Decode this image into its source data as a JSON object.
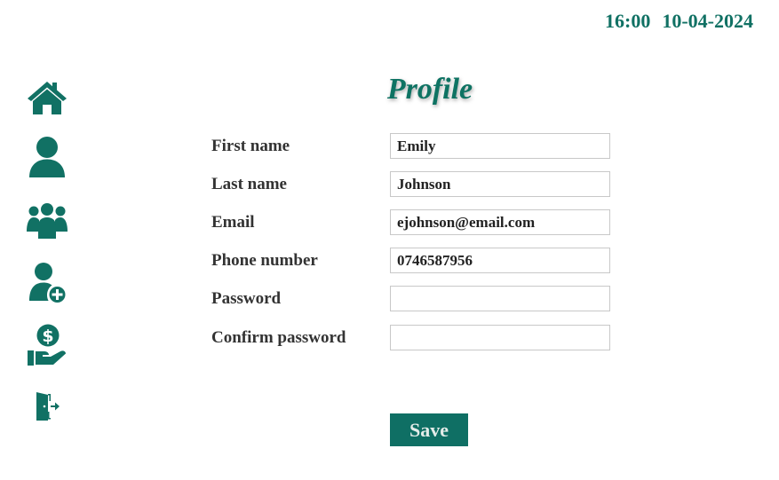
{
  "header": {
    "time": "16:00",
    "date": "10-04-2024"
  },
  "colors": {
    "accent": "#117164",
    "button_bg": "#0f6f64",
    "label_text": "#333333"
  },
  "sidebar": {
    "items": [
      {
        "icon": "home-icon"
      },
      {
        "icon": "user-icon"
      },
      {
        "icon": "users-group-icon"
      },
      {
        "icon": "user-add-icon"
      },
      {
        "icon": "hand-money-icon"
      },
      {
        "icon": "logout-door-icon"
      }
    ]
  },
  "main": {
    "title": "Profile",
    "fields": {
      "first_name": {
        "label": "First name",
        "value": "Emily"
      },
      "last_name": {
        "label": "Last name",
        "value": "Johnson"
      },
      "email": {
        "label": "Email",
        "value": "ejohnson@email.com"
      },
      "phone": {
        "label": "Phone number",
        "value": "0746587956"
      },
      "password": {
        "label": "Password",
        "value": ""
      },
      "confirm_password": {
        "label": "Confirm password",
        "value": ""
      }
    },
    "save_label": "Save"
  }
}
